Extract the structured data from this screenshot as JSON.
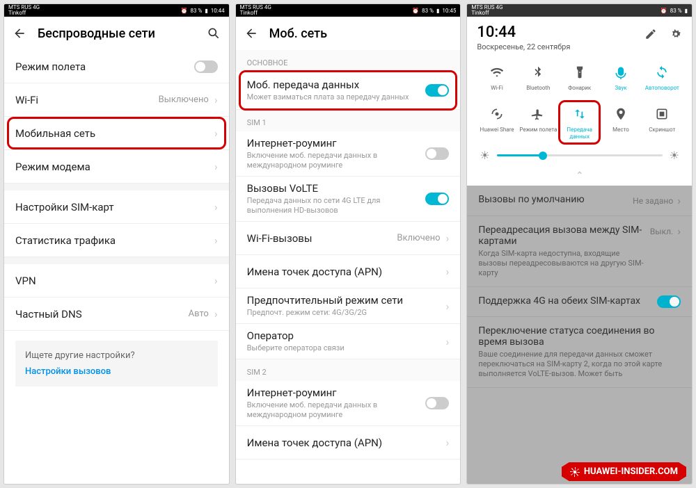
{
  "statusbar": {
    "carrier_l1": "MTS RUS 4G",
    "carrier_l2": "Tinkoff",
    "batt1": "83 %",
    "time1": "10:44",
    "time2": "10:45"
  },
  "p1": {
    "title": "Беспроводные сети",
    "rows": {
      "airplane": "Режим полета",
      "wifi": "Wi-Fi",
      "wifi_val": "Выключено",
      "mobile": "Мобильная сеть",
      "tether": "Режим модема",
      "sim": "Настройки SIM-карт",
      "stats": "Статистика трафика",
      "vpn": "VPN",
      "dns": "Частный DNS",
      "dns_val": "Авто"
    },
    "hint_q": "Ищете другие настройки?",
    "hint_link": "Настройки вызовов"
  },
  "p2": {
    "title": "Моб. сеть",
    "sec_main": "ОСНОВНОЕ",
    "mobdata": "Моб. передача данных",
    "mobdata_sub": "Может взиматься плата за передачу данных",
    "sec_sim1": "SIM 1",
    "roam": "Интернет-роуминг",
    "roam_sub": "Включение моб. передачи данных в международном роуминге",
    "volte": "Вызовы VoLTE",
    "volte_sub": "Передача данных по сети 4G LTE для выполнения HD-вызовов",
    "wificall": "Wi-Fi-вызовы",
    "wificall_val": "Включено",
    "apn": "Имена точек доступа (APN)",
    "netmode": "Предпочтительный режим сети",
    "netmode_sub": "Предпочт. режим сети: 4G/3G/2G",
    "oper": "Оператор",
    "oper_sub": "Выберите оператора связи",
    "sec_sim2": "SIM 2",
    "roam2": "Интернет-роуминг",
    "roam2_sub": "Включение моб. передачи данных в международном роуминге",
    "apn2": "Имена точек доступа (APN)"
  },
  "p3": {
    "time": "10:44",
    "date": "Воскресенье, 22 сентября",
    "tiles": [
      {
        "name": "wifi",
        "label": "Wi-Fi",
        "active": false
      },
      {
        "name": "bluetooth",
        "label": "Bluetooth",
        "active": false
      },
      {
        "name": "flashlight",
        "label": "Фонарик",
        "active": false
      },
      {
        "name": "sound",
        "label": "Звук",
        "active": true
      },
      {
        "name": "autorotate",
        "label": "Автоповорот",
        "active": true
      },
      {
        "name": "huawei-share",
        "label": "Huawei Share",
        "active": false
      },
      {
        "name": "airplane",
        "label": "Режим полета",
        "active": false
      },
      {
        "name": "mobile-data",
        "label": "Передача данных",
        "active": true
      },
      {
        "name": "location",
        "label": "Место",
        "active": false
      },
      {
        "name": "screenshot",
        "label": "Скриншот",
        "active": false
      }
    ],
    "dim": {
      "defcall": "Вызовы по умолчанию",
      "defcall_val": "Не задано",
      "fwd": "Переадресация вызова между SIM-картами",
      "fwd_sub": "Когда SIM-карта недоступна, входящие вызовы переадресовываются на другую SIM-карту",
      "fwd_val": "Выкл.",
      "both4g": "Поддержка 4G на обеих SIM-картах",
      "switch": "Переключение статуса соединения во время вызова",
      "switch_sub": "Ваше соединение для передачи данных сможет переключаться на SIM-карту 2, когда по этой карте выполняется VoLTE-вызов. Может быть"
    }
  },
  "watermark": "HUAWEI-INSIDER.COM"
}
